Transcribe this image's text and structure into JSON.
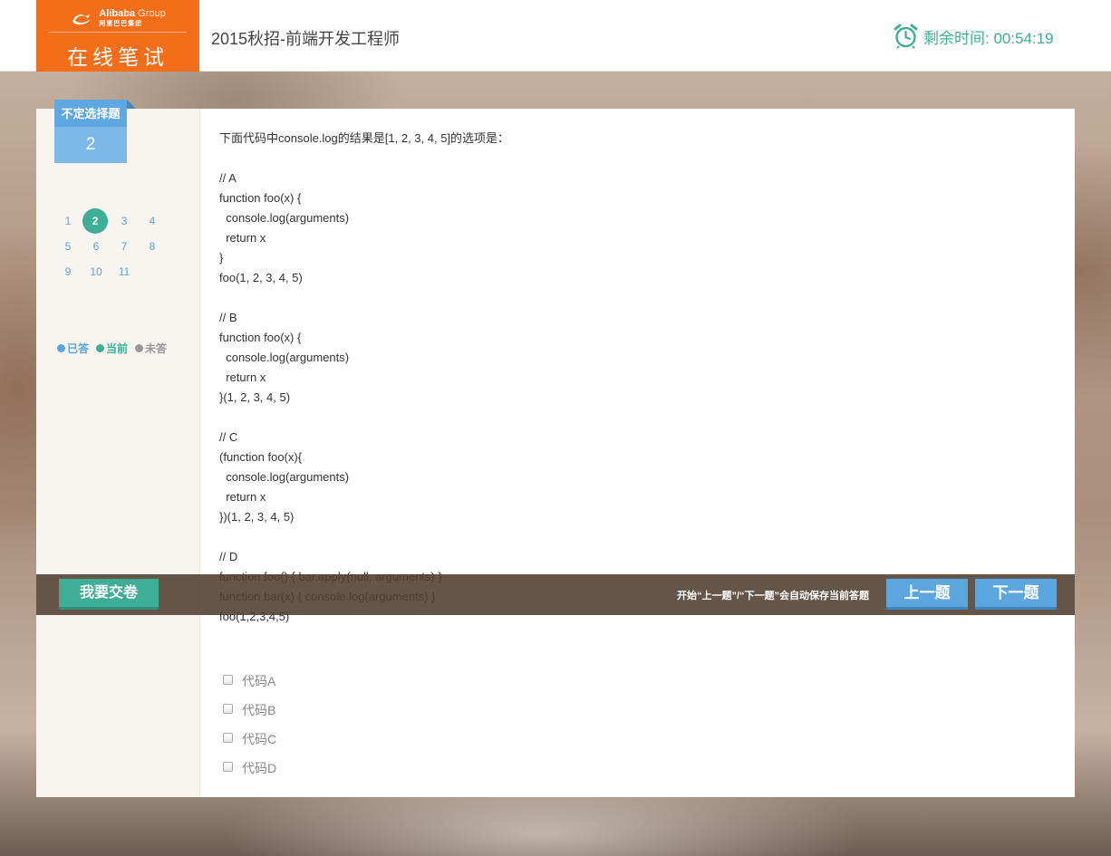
{
  "header": {
    "logo_brand": "Alibaba",
    "logo_group": "Group",
    "logo_sub": "阿里巴巴集团",
    "logo_title": "在线笔试",
    "exam_title": "2015秋招-前端开发工程师",
    "timer_label": "剩余时间: 00:54:19",
    "timer_icon": "alarm-clock-icon",
    "accent_color": "#3fae96",
    "brand_color": "#f46e1a"
  },
  "sidebar": {
    "question_type": "不定选择题",
    "question_number": "2",
    "question_numbers": [
      "1",
      "2",
      "3",
      "4",
      "5",
      "6",
      "7",
      "8",
      "9",
      "10",
      "11"
    ],
    "current_question": "2",
    "legend": {
      "answered": "已答",
      "current": "当前",
      "unanswered": "未答",
      "answered_color": "#5aa5dc",
      "current_color": "#3fae96",
      "unanswered_color": "#999999"
    }
  },
  "question": {
    "text": "下面代码中console.log的结果是[1, 2, 3, 4, 5]的选项是：",
    "code": "// A\nfunction foo(x) {\n  console.log(arguments)\n  return x\n}\nfoo(1, 2, 3, 4, 5)\n\n// B\nfunction foo(x) {\n  console.log(arguments)\n  return x\n}(1, 2, 3, 4, 5)\n\n// C\n(function foo(x){\n  console.log(arguments)\n  return x\n})(1, 2, 3, 4, 5)\n\n// D\nfunction foo() { bar.apply(null, arguments) }\nfunction bar(x) { console.log(arguments) }\nfoo(1,2,3,4,5)",
    "options": [
      "代码A",
      "代码B",
      "代码C",
      "代码D"
    ]
  },
  "actionbar": {
    "submit_label": "我要交卷",
    "hint": "开始“上一题”/“下一题”会自动保存当前答题",
    "prev_label": "上一题",
    "next_label": "下一题"
  }
}
